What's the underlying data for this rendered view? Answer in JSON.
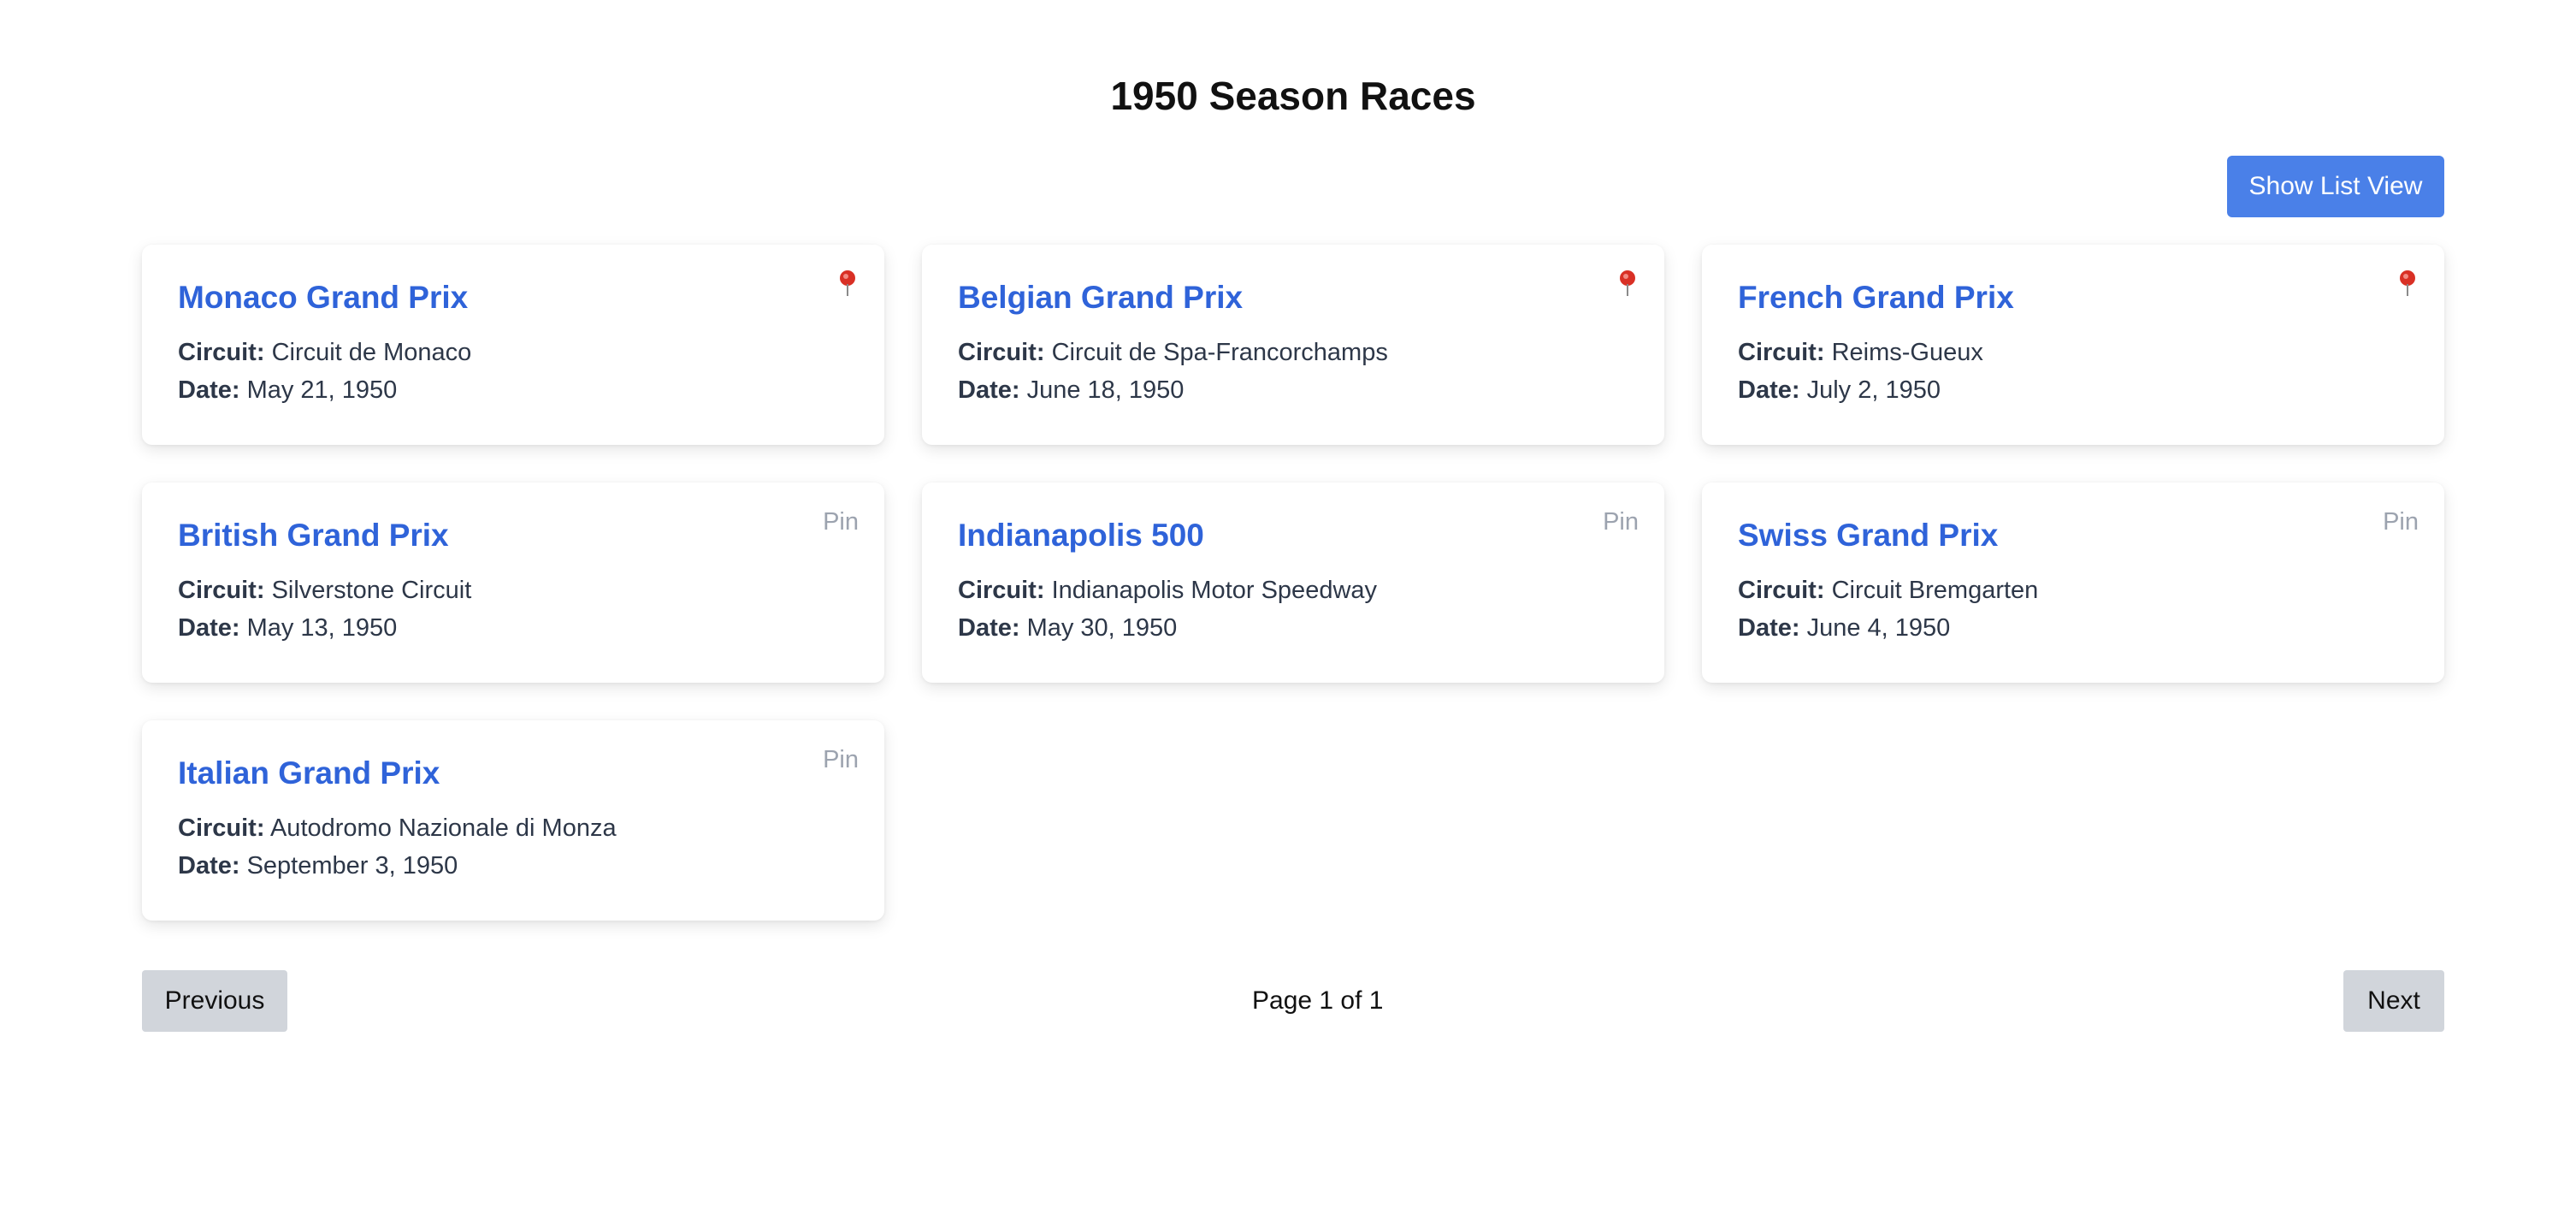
{
  "page": {
    "title": "1950 Season Races"
  },
  "toolbar": {
    "toggle_view_label": "Show List View"
  },
  "labels": {
    "circuit": "Circuit:",
    "date": "Date:"
  },
  "races": [
    {
      "name": "Monaco Grand Prix",
      "circuit": "Circuit de Monaco",
      "date": "May 21, 1950",
      "pinned": true
    },
    {
      "name": "Belgian Grand Prix",
      "circuit": "Circuit de Spa-Francorchamps",
      "date": "June 18, 1950",
      "pinned": true
    },
    {
      "name": "French Grand Prix",
      "circuit": "Reims-Gueux",
      "date": "July 2, 1950",
      "pinned": true
    },
    {
      "name": "British Grand Prix",
      "circuit": "Silverstone Circuit",
      "date": "May 13, 1950",
      "pinned": false,
      "pin_label": "Pin"
    },
    {
      "name": "Indianapolis 500",
      "circuit": "Indianapolis Motor Speedway",
      "date": "May 30, 1950",
      "pinned": false,
      "pin_label": "Pin"
    },
    {
      "name": "Swiss Grand Prix",
      "circuit": "Circuit Bremgarten",
      "date": "June 4, 1950",
      "pinned": false,
      "pin_label": "Pin"
    },
    {
      "name": "Italian Grand Prix",
      "circuit": "Autodromo Nazionale di Monza",
      "date": "September 3, 1950",
      "pinned": false,
      "pin_label": "Pin"
    }
  ],
  "pagination": {
    "previous_label": "Previous",
    "next_label": "Next",
    "indicator": "Page 1 of 1"
  },
  "colors": {
    "accent": "#4a80e8",
    "race_title": "#2f63d9",
    "pin_icon": "#d93025"
  },
  "icons": {
    "pinned": "pushpin-icon"
  }
}
